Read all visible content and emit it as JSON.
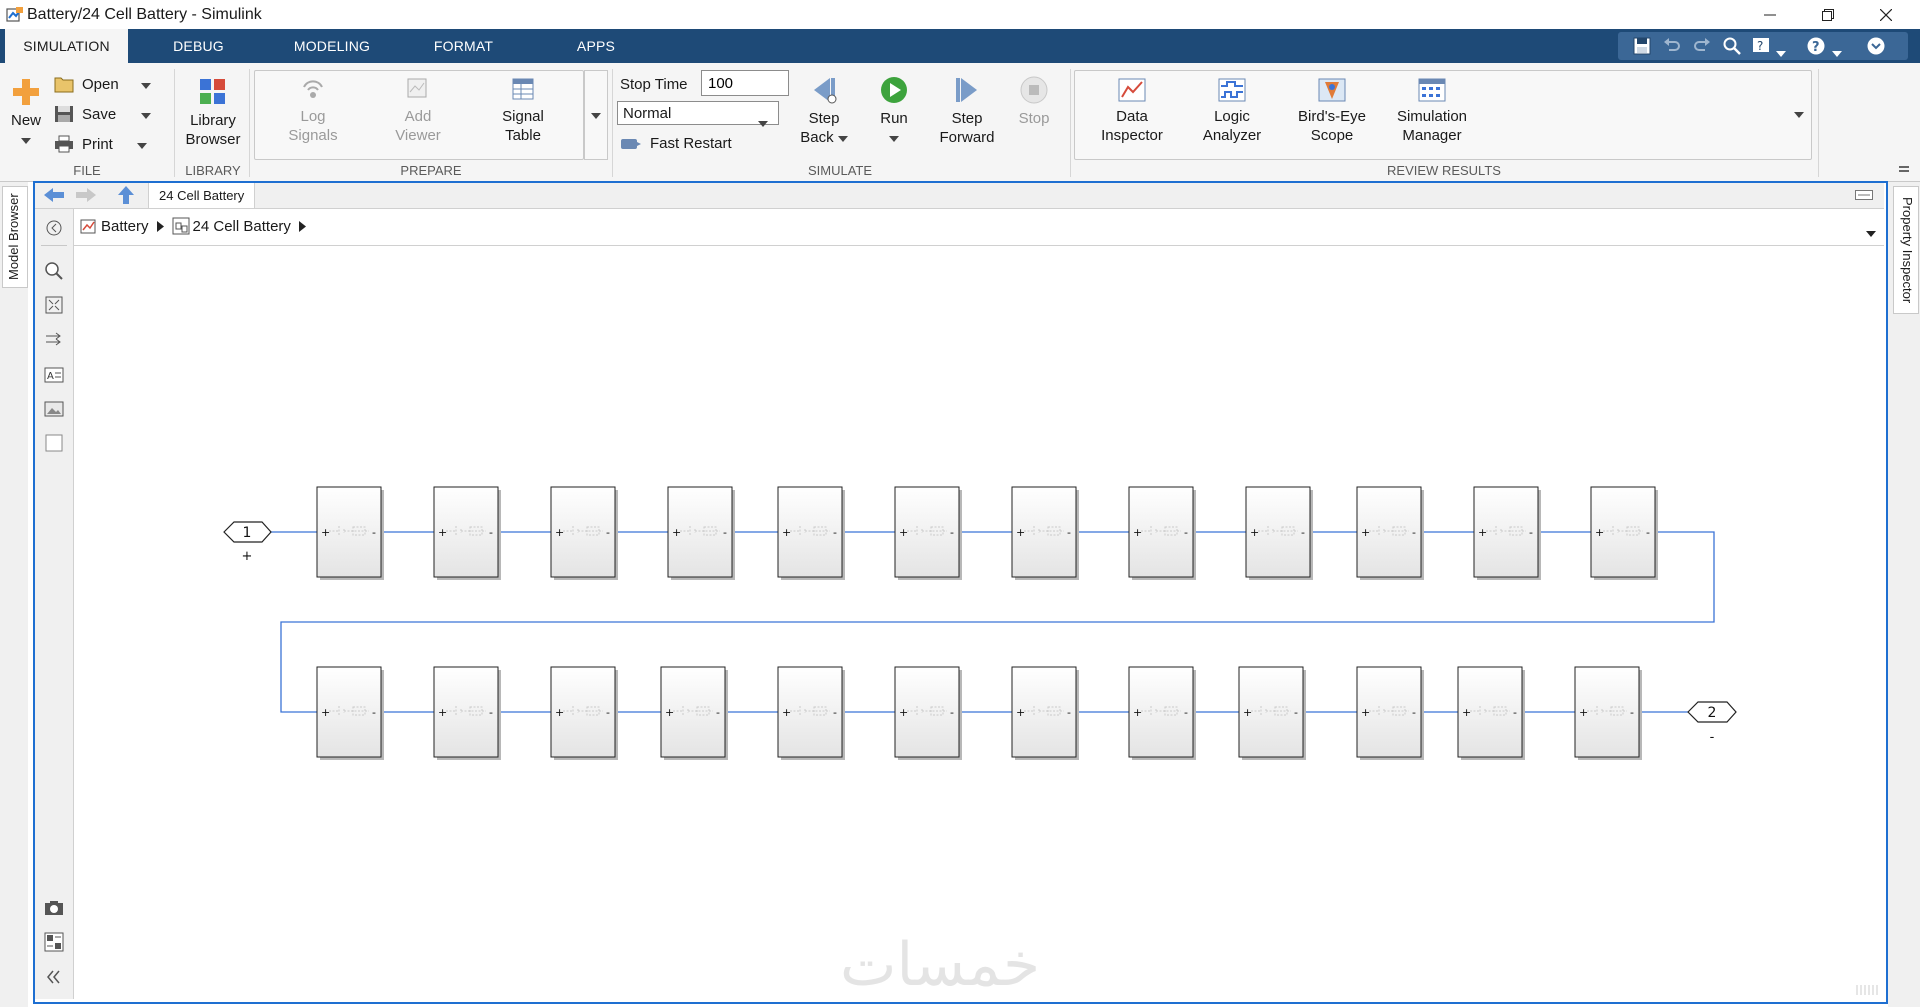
{
  "window": {
    "title": "Battery/24 Cell Battery - Simulink"
  },
  "tabs": [
    {
      "label": "SIMULATION",
      "active": true
    },
    {
      "label": "DEBUG",
      "active": false
    },
    {
      "label": "MODELING",
      "active": false
    },
    {
      "label": "FORMAT",
      "active": false
    },
    {
      "label": "APPS",
      "active": false
    }
  ],
  "ribbon": {
    "file": {
      "title": "FILE",
      "new_label": "New",
      "open_label": "Open",
      "save_label": "Save",
      "print_label": "Print"
    },
    "library": {
      "title": "LIBRARY",
      "browser_label_1": "Library",
      "browser_label_2": "Browser"
    },
    "prepare": {
      "title": "PREPARE",
      "log_signals_1": "Log",
      "log_signals_2": "Signals",
      "add_viewer_1": "Add",
      "add_viewer_2": "Viewer",
      "signal_table_1": "Signal",
      "signal_table_2": "Table"
    },
    "simulate": {
      "title": "SIMULATE",
      "stop_time_label": "Stop Time",
      "stop_time_value": "100",
      "mode_value": "Normal",
      "fast_restart_label": "Fast Restart",
      "step_back_1": "Step",
      "step_back_2": "Back",
      "run_label": "Run",
      "step_forward_1": "Step",
      "step_forward_2": "Forward",
      "stop_label": "Stop"
    },
    "review": {
      "title": "REVIEW RESULTS",
      "data_inspector_1": "Data",
      "data_inspector_2": "Inspector",
      "logic_analyzer_1": "Logic",
      "logic_analyzer_2": "Analyzer",
      "birds_eye_1": "Bird's-Eye",
      "birds_eye_2": "Scope",
      "sim_manager_1": "Simulation",
      "sim_manager_2": "Manager"
    }
  },
  "side_tabs": {
    "left": "Model Browser",
    "right": "Property Inspector"
  },
  "editor": {
    "tab_label": "24 Cell Battery",
    "breadcrumb": [
      "Battery",
      "24 Cell Battery"
    ]
  },
  "diagram": {
    "inport": {
      "number": "1",
      "sign": "+"
    },
    "outport": {
      "number": "2",
      "sign": "-"
    },
    "cells_per_row": 12,
    "rows": 2,
    "cell_pos_sign": "+",
    "cell_neg_sign": "-",
    "wire_color": "#3b73d6"
  },
  "watermark": "خمسات"
}
